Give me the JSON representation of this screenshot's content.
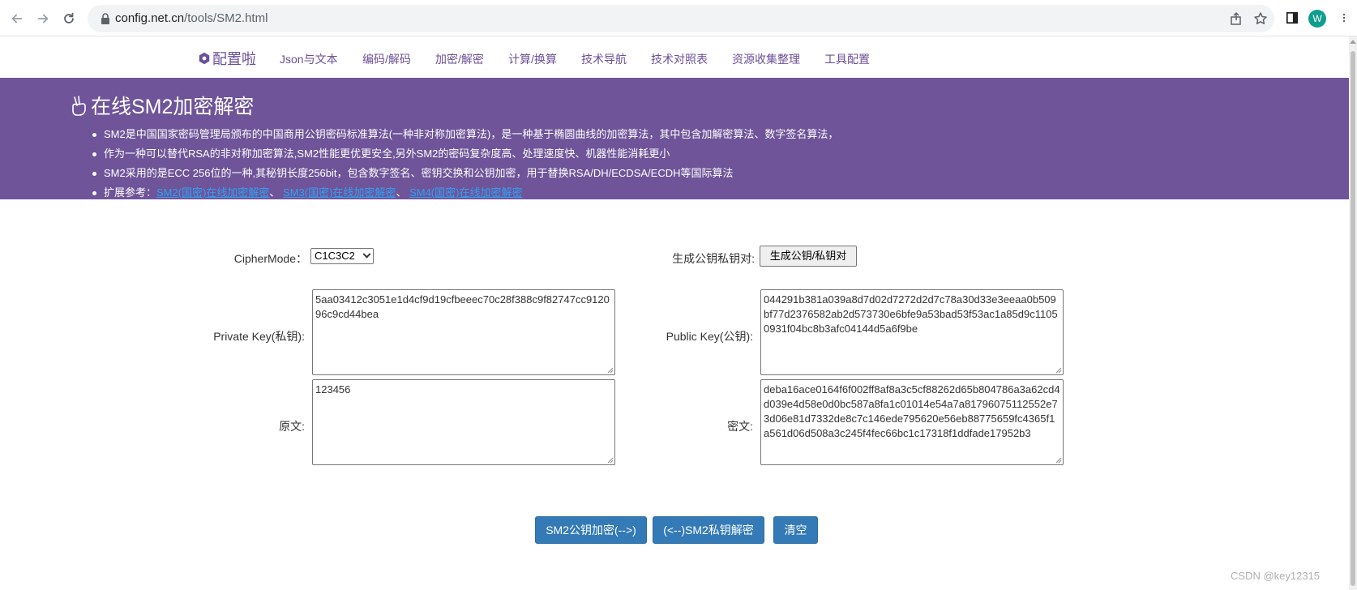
{
  "browser": {
    "url_domain": "config.net.cn",
    "url_path": "/tools/SM2.html",
    "profile_initial": "W"
  },
  "site": {
    "brand": "配置啦",
    "menu": [
      "Json与文本",
      "编码/解码",
      "加密/解密",
      "计算/换算",
      "技术导航",
      "技术对照表",
      "资源收集整理",
      "工具配置"
    ]
  },
  "banner": {
    "title": "在线SM2加密解密",
    "bullets": [
      "SM2是中国国家密码管理局颁布的中国商用公钥密码标准算法(一种非对称加密算法)，是一种基于椭圆曲线的加密算法，其中包含加解密算法、数字签名算法，",
      "作为一种可以替代RSA的非对称加密算法,SM2性能更优更安全,另外SM2的密码复杂度高、处理速度快、机器性能消耗更小",
      "SM2采用的是ECC 256位的一种,其秘钥长度256bit，包含数字签名、密钥交换和公钥加密，用于替换RSA/DH/ECDSA/ECDH等国际算法"
    ],
    "ext_label": "扩展参考：",
    "ext_links": [
      "SM2(国密)在线加密解密",
      "SM3(国密)在线加密解密",
      "SM4(国密)在线加密解密"
    ],
    "ext_sep": "、"
  },
  "form": {
    "cipher_mode_label": "CipherMode：",
    "cipher_mode_value": "C1C3C2",
    "gen_label": "生成公钥私钥对:",
    "gen_button": "生成公钥/私钥对",
    "private_key_label": "Private Key(私钥):",
    "private_key_value": "5aa03412c3051e1d4cf9d19cfbeeec70c28f388c9f82747cc912096c9cd44bea",
    "public_key_label": "Public Key(公钥):",
    "public_key_value": "044291b381a039a8d7d02d7272d2d7c78a30d33e3eeaa0b509bf77d2376582ab2d573730e6bfe9a53bad53f53ac1a85d9c11050931f04bc8b3afc04144d5a6f9be",
    "plaintext_label": "原文:",
    "plaintext_value": "123456",
    "ciphertext_label": "密文:",
    "ciphertext_value": "deba16ace0164f6f002ff8af8a3c5cf88262d65b804786a3a62cd4d039e4d58e0d0bc587a8fa1c01014e54a7a81796075112552e73d06e81d7332de8c7c146ede795620e56eb88775659fc4365f1a561d06d508a3c245f4fec66bc1c17318f1ddfade17952b3"
  },
  "actions": {
    "encrypt": "SM2公钥加密(-->)",
    "decrypt": "(<--)SM2私钥解密",
    "clear": "清空"
  },
  "watermark": "CSDN @key12315"
}
